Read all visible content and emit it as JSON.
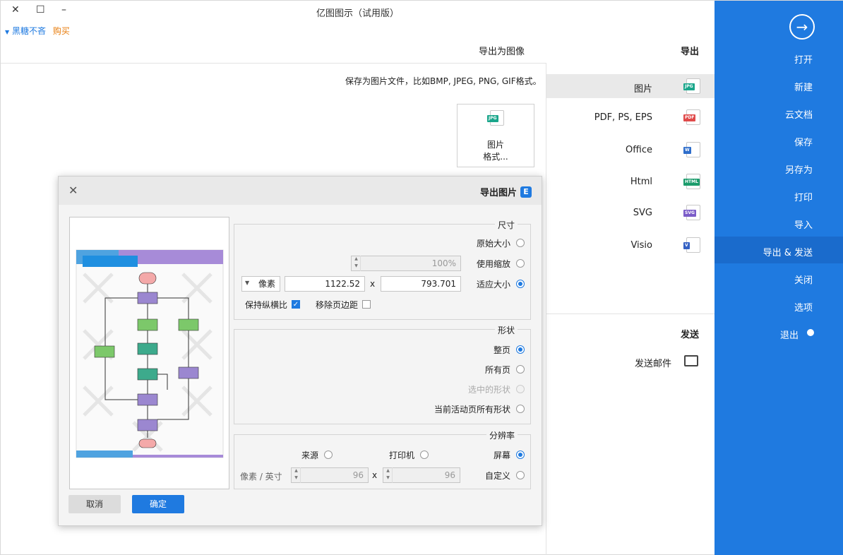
{
  "window": {
    "title": "亿图图示（试用版）",
    "minimize": "–",
    "maximize": "☐",
    "close": "✕"
  },
  "topbar": {
    "account": "黑糖不吝",
    "buy": "购买"
  },
  "header": {
    "left": "导出为图像",
    "right": "导出"
  },
  "nav": {
    "items": [
      "打开",
      "新建",
      "云文档",
      "保存",
      "另存为",
      "打印",
      "导入",
      "导出 & 发送",
      "关闭",
      "选项",
      "退出"
    ],
    "selected": "导出 & 发送"
  },
  "export": {
    "items": [
      {
        "label": "图片",
        "icon": "jpg-file-icon",
        "badge": "JPG",
        "color": "#1aa68b"
      },
      {
        "label": "PDF, PS, EPS",
        "icon": "pdf-file-icon",
        "badge": "PDF",
        "color": "#e04a4a"
      },
      {
        "label": "Office",
        "icon": "word-file-icon",
        "badge": "W",
        "color": "#2f6ecb"
      },
      {
        "label": "Html",
        "icon": "html-file-icon",
        "badge": "HTML",
        "color": "#1c9c6c"
      },
      {
        "label": "SVG",
        "icon": "svg-file-icon",
        "badge": "SVG",
        "color": "#7b5cc8"
      },
      {
        "label": "Visio",
        "icon": "visio-file-icon",
        "badge": "V",
        "color": "#3461c4"
      }
    ],
    "selected": "图片"
  },
  "send": {
    "heading": "发送",
    "email_label": "发送邮件"
  },
  "description": "保存为图片文件，比如BMP, JPEG, PNG, GIF格式。",
  "image_card": {
    "line1": "图片",
    "line2": "格式..."
  },
  "dialog": {
    "title": "导出图片",
    "size_group": "尺寸",
    "size_options": [
      "原始大小",
      "使用缩放",
      "适应大小"
    ],
    "size_selected": "适应大小",
    "zoom_value": "100%",
    "width_value": "793.701",
    "height_value": "1122.52",
    "x_sep": "x",
    "unit_value": "像素",
    "remove_margin": "移除页边距",
    "keep_ratio": "保持纵横比",
    "shape_group": "形状",
    "shape_options": [
      "整页",
      "所有页",
      "选中的形状",
      "当前活动页所有形状"
    ],
    "shape_selected": "整页",
    "res_group": "分辨率",
    "res_screen": "屏幕",
    "res_printer": "打印机",
    "res_source": "来源",
    "res_custom": "自定义",
    "dpi_x": "96",
    "dpi_y": "96",
    "dpi_unit": "像素 / 英寸",
    "ok": "确定",
    "cancel": "取消"
  }
}
